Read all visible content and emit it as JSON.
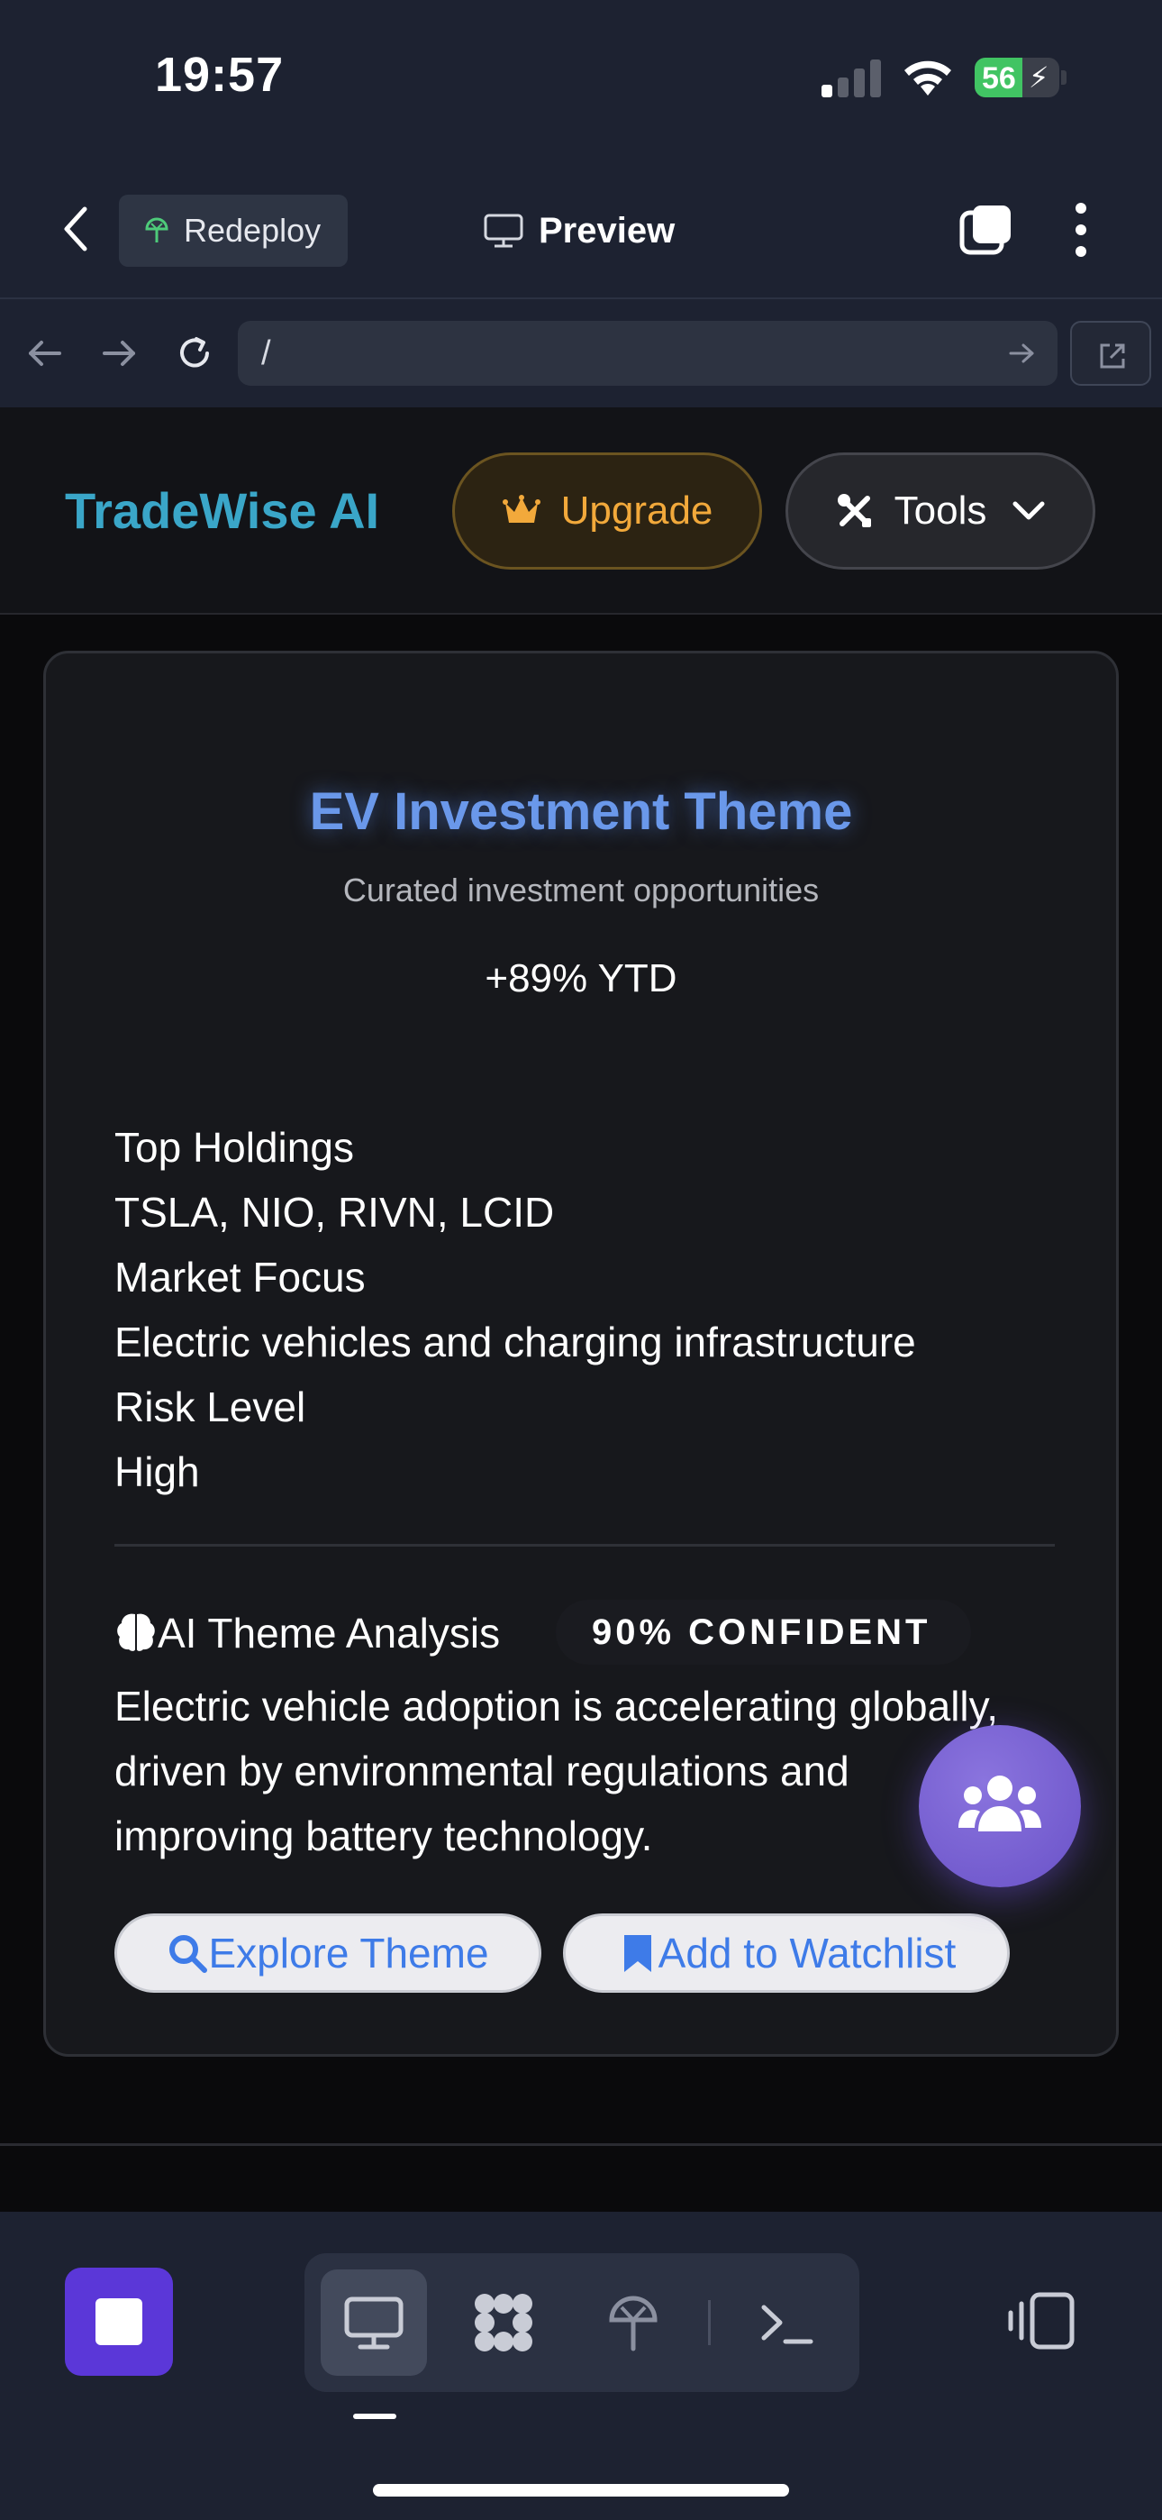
{
  "status_bar": {
    "time": "19:57",
    "battery_percent": "56"
  },
  "browser_nav": {
    "redeploy_label": "Redeploy",
    "preview_label": "Preview",
    "url": "/"
  },
  "app_header": {
    "brand": "TradeWise AI",
    "upgrade_label": "Upgrade",
    "tools_label": "Tools"
  },
  "theme_card": {
    "title": "EV Investment Theme",
    "subtitle": "Curated investment opportunities",
    "performance": "+89% YTD",
    "details": {
      "holdings_label": "Top Holdings",
      "holdings_value": "TSLA, NIO, RIVN, LCID",
      "focus_label": "Market Focus",
      "focus_value": "Electric vehicles and charging infrastructure",
      "risk_label": "Risk Level",
      "risk_value": "High"
    },
    "ai_analysis": {
      "label": "AI Theme Analysis",
      "confidence": "90% CONFIDENT",
      "text": "Electric vehicle adoption is accelerating globally, driven by environmental regulations and improving battery technology."
    },
    "buttons": {
      "explore": "Explore Theme",
      "watchlist": "Add to Watchlist"
    }
  },
  "colors": {
    "brand": "#3aa6c8",
    "title_blue": "#6a98ea",
    "upgrade_orange": "#f2a93b",
    "fab_purple": "#6a52c8",
    "stop_purple": "#5b37d8"
  },
  "icons": {
    "fab": "users-icon",
    "explore": "search-icon",
    "watchlist": "bookmark-icon",
    "upgrade": "crown-icon",
    "tools": "tools-icon"
  }
}
